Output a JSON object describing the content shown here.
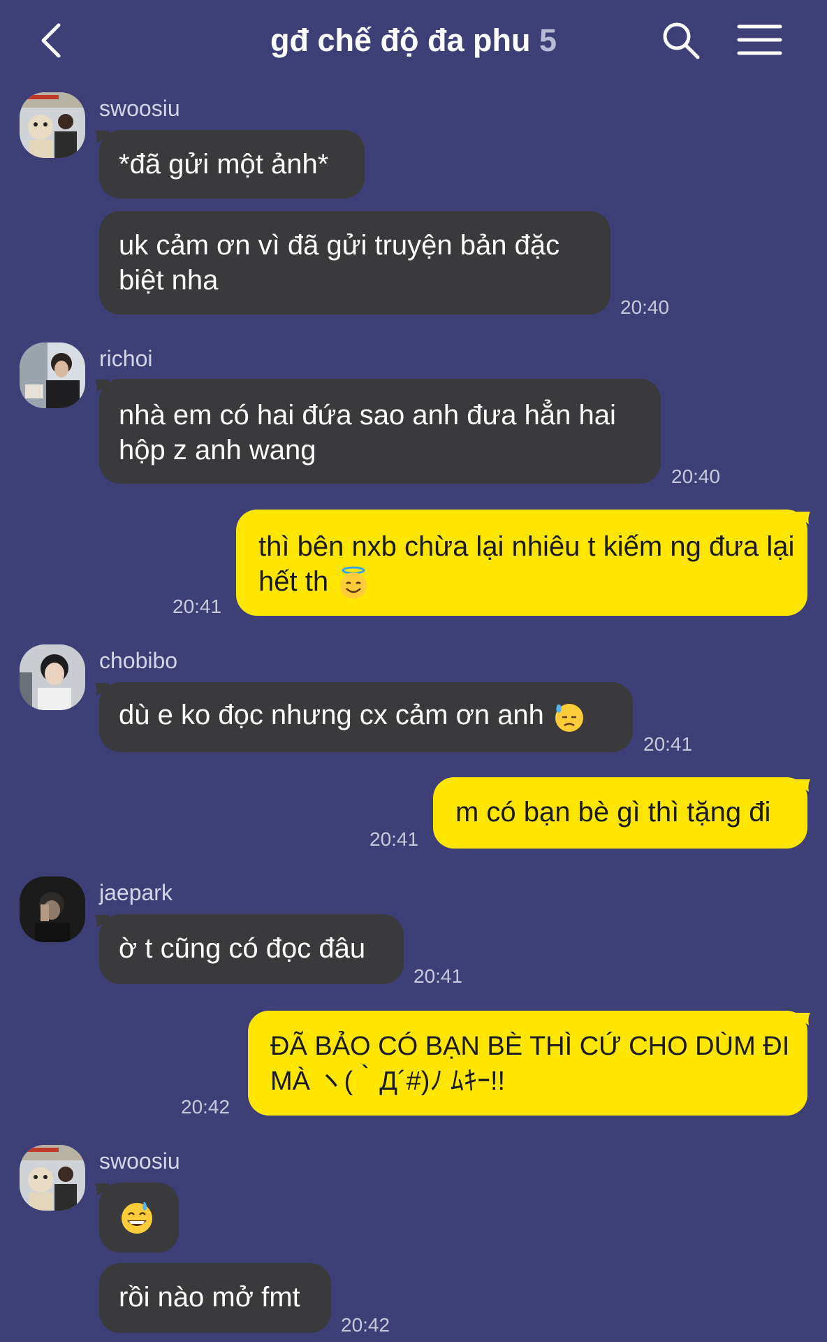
{
  "header": {
    "title": "gđ chế độ đa phu",
    "member_count": "5",
    "back_icon": "chevron-left-icon",
    "search_icon": "search-icon",
    "menu_icon": "hamburger-menu-icon"
  },
  "colors": {
    "background": "#3d3f76",
    "incoming_bubble": "#3a3a3c",
    "outgoing_bubble": "#ffe600"
  },
  "messages": [
    {
      "sender": "swoosiu",
      "text": "*đã gửi một ảnh*"
    },
    {
      "sender": "swoosiu",
      "text": "uk cảm ơn vì đã gửi truyện bản đặc biệt nha",
      "time": "20:40"
    },
    {
      "sender": "richoi",
      "text": "nhà em có hai đứa sao anh đưa hẳn hai hộp z anh wang",
      "time": "20:40"
    },
    {
      "sender": "me",
      "text": "thì bên nxb chừa lại nhiêu t kiếm ng đưa lại hết th",
      "emoji": "smiling-face-with-halo-icon",
      "time": "20:41"
    },
    {
      "sender": "chobibo",
      "text": "dù e ko đọc nhưng cx cảm ơn anh",
      "emoji": "downcast-face-with-sweat-icon",
      "time": "20:41"
    },
    {
      "sender": "me",
      "text": "m có bạn bè gì thì tặng đi",
      "time": "20:41"
    },
    {
      "sender": "jaepark",
      "text": "ờ t cũng có đọc đâu",
      "time": "20:41"
    },
    {
      "sender": "me",
      "text": "ĐÃ BẢO CÓ BẠN BÈ THÌ CỨ CHO DÙM ĐI MÀ ヽ(｀Д´#)ﾉ ﾑｷｰ!!",
      "time": "20:42"
    },
    {
      "sender": "swoosiu",
      "emoji": "grinning-face-with-sweat-icon"
    },
    {
      "sender": "swoosiu",
      "text": "rồi nào mở fmt",
      "time": "20:42"
    }
  ]
}
